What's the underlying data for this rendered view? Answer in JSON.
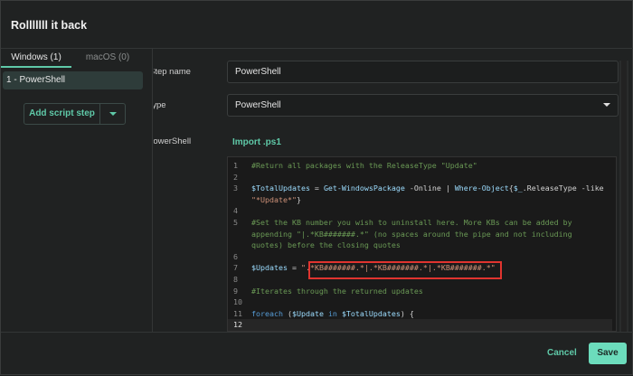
{
  "dialog": {
    "title": "Rolllllll it back"
  },
  "tabs": [
    {
      "label": "Windows (1)"
    },
    {
      "label": "macOS (0)"
    }
  ],
  "steps": [
    {
      "label": "1 - PowerShell"
    }
  ],
  "add_step_label": "Add script step",
  "form": {
    "step_name_label": "Step name",
    "step_name_value": "PowerShell",
    "type_label": "Type",
    "type_value": "PowerShell",
    "powershell_label": "PowerShell",
    "import_label": "Import .ps1"
  },
  "code_lines": [
    {
      "n": "1",
      "tokens": [
        {
          "k": "comment",
          "t": "#Return all packages with the ReleaseType \"Update\""
        }
      ]
    },
    {
      "n": "2",
      "tokens": []
    },
    {
      "n": "3",
      "tokens": [
        {
          "k": "var",
          "t": "$TotalUpdates"
        },
        {
          "k": "plain",
          "t": " = "
        },
        {
          "k": "cmd",
          "t": "Get-WindowsPackage"
        },
        {
          "k": "plain",
          "t": " -Online | "
        },
        {
          "k": "cmd",
          "t": "Where-Object"
        },
        {
          "k": "plain",
          "t": "{"
        },
        {
          "k": "var",
          "t": "$_"
        },
        {
          "k": "plain",
          "t": ".ReleaseType -like "
        },
        {
          "k": "str",
          "t": "\"*Update*\""
        },
        {
          "k": "plain",
          "t": "}"
        }
      ]
    },
    {
      "n": "4",
      "tokens": []
    },
    {
      "n": "5",
      "tokens": [
        {
          "k": "comment",
          "t": "#Set the KB number you wish to uninstall here. More KBs can be added by appending \"|.*KB#######.*\" (no spaces around the pipe and not including quotes) before the closing quotes"
        }
      ]
    },
    {
      "n": "6",
      "tokens": []
    },
    {
      "n": "7",
      "tokens": [
        {
          "k": "var",
          "t": "$Updates"
        },
        {
          "k": "plain",
          "t": " = "
        },
        {
          "k": "str",
          "t": "\".*KB#######.*|.*KB#######.*|.*KB#######.*\""
        }
      ]
    },
    {
      "n": "8",
      "tokens": []
    },
    {
      "n": "9",
      "tokens": [
        {
          "k": "comment",
          "t": "#Iterates through the returned updates"
        }
      ]
    },
    {
      "n": "10",
      "tokens": []
    },
    {
      "n": "11",
      "tokens": [
        {
          "k": "kw",
          "t": "foreach"
        },
        {
          "k": "plain",
          "t": " ("
        },
        {
          "k": "var",
          "t": "$Update"
        },
        {
          "k": "plain",
          "t": " "
        },
        {
          "k": "kw",
          "t": "in"
        },
        {
          "k": "plain",
          "t": " "
        },
        {
          "k": "var",
          "t": "$TotalUpdates"
        },
        {
          "k": "plain",
          "t": ") {"
        }
      ]
    },
    {
      "n": "12",
      "tokens": [],
      "current": true
    }
  ],
  "footer": {
    "cancel_label": "Cancel",
    "save_label": "Save"
  }
}
